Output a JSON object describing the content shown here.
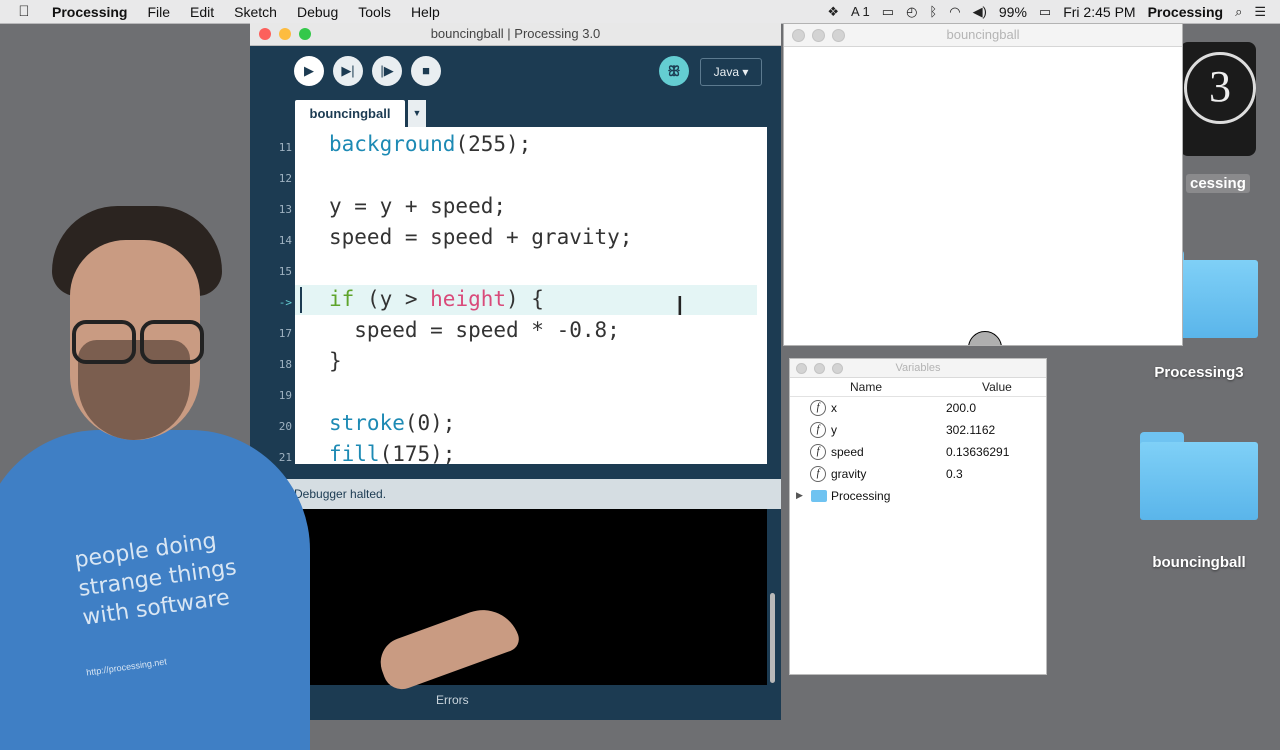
{
  "menubar": {
    "app_name": "Processing",
    "items": [
      "File",
      "Edit",
      "Sketch",
      "Debug",
      "Tools",
      "Help"
    ],
    "battery": "99%",
    "clock": "Fri 2:45 PM",
    "active_app": "Processing"
  },
  "desktop": {
    "icons": [
      {
        "label": "Processing3"
      },
      {
        "label": "bouncingball"
      }
    ],
    "app_icon_label": "cessing"
  },
  "ide": {
    "title": "bouncingball | Processing 3.0",
    "mode_label": "Java ▾",
    "file_tab": "bouncingball",
    "console_status": "Debugger halted.",
    "errors_label": "Errors",
    "line_numbers": [
      "11",
      "12",
      "13",
      "14",
      "15",
      "->",
      "17",
      "18",
      "19",
      "20",
      "21"
    ],
    "code": {
      "l11_fn": "background",
      "l11_rest": "(255);",
      "l13": "y = y + speed;",
      "l14": "speed = speed + gravity;",
      "l16_if": "if",
      "l16_mid": " (y > ",
      "l16_var": "height",
      "l16_end": ") {",
      "l17": "  speed = speed * -0.8;",
      "l18": "}",
      "l20_fn": "stroke",
      "l20_rest": "(0);",
      "l21_fn": "fill",
      "l21_rest": "(175);"
    }
  },
  "sketch": {
    "title": "bouncingball"
  },
  "variables": {
    "title": "Variables",
    "col_name": "Name",
    "col_value": "Value",
    "rows": [
      {
        "name": "x",
        "value": "200.0"
      },
      {
        "name": "y",
        "value": "302.1162"
      },
      {
        "name": "speed",
        "value": "0.13636291"
      },
      {
        "name": "gravity",
        "value": "0.3"
      }
    ],
    "folder_row": "Processing"
  },
  "shirt": {
    "line1": "people doing",
    "line2": "strange things",
    "line3": "with software",
    "url": "http://processing.net"
  }
}
